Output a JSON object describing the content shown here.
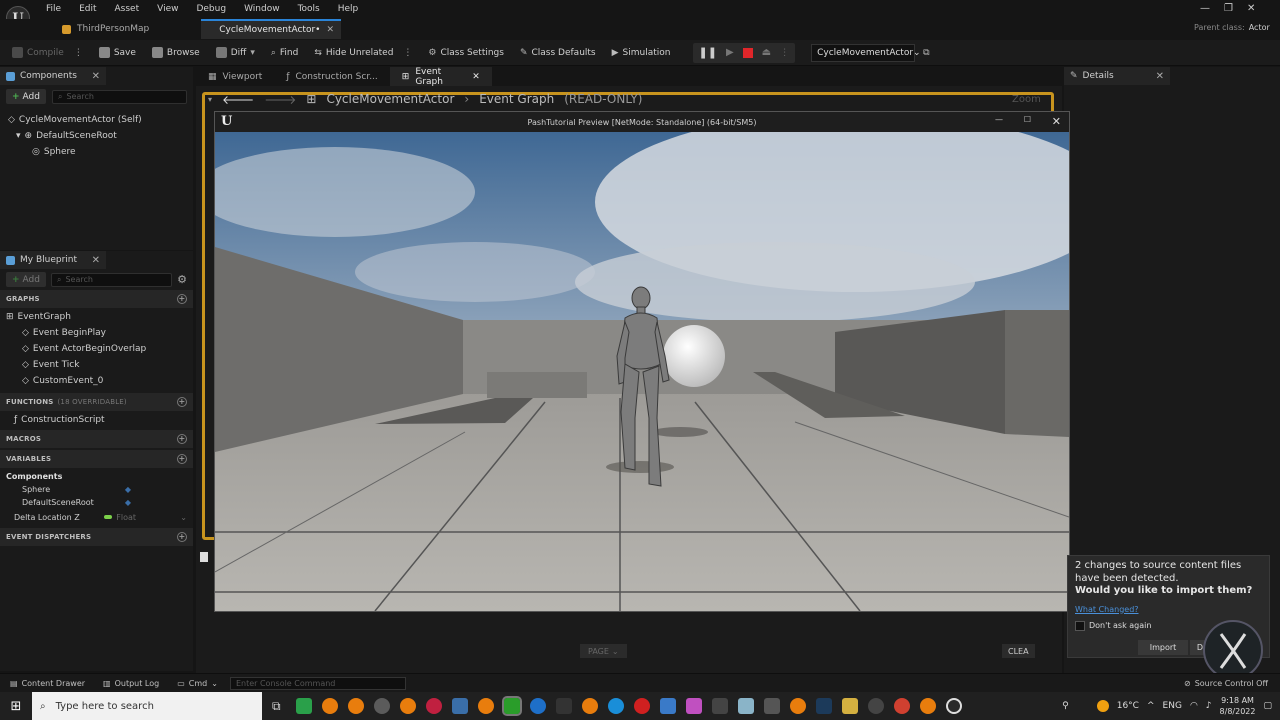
{
  "menubar": {
    "items": [
      "File",
      "Edit",
      "Asset",
      "View",
      "Debug",
      "Window",
      "Tools",
      "Help"
    ],
    "parent_class_label": "Parent class:",
    "parent_class_value": "Actor"
  },
  "tabs": [
    {
      "label": "ThirdPersonMap"
    },
    {
      "label": "CycleMovementActor•"
    }
  ],
  "toolbar": {
    "compile": "Compile",
    "save": "Save",
    "browse": "Browse",
    "diff": "Diff",
    "find": "Find",
    "hide_unrelated": "Hide Unrelated",
    "class_settings": "Class Settings",
    "class_defaults": "Class Defaults",
    "simulation": "Simulation",
    "debug_object": "CycleMovementActor"
  },
  "components_panel": {
    "title": "Components",
    "add": "Add",
    "search_placeholder": "Search",
    "tree": [
      "CycleMovementActor (Self)",
      "DefaultSceneRoot",
      "Sphere"
    ]
  },
  "my_blueprint": {
    "title": "My Blueprint",
    "add": "Add",
    "search_placeholder": "Search",
    "graphs_header": "GRAPHS",
    "event_graph": "EventGraph",
    "events": [
      "Event BeginPlay",
      "Event ActorBeginOverlap",
      "Event Tick",
      "CustomEvent_0"
    ],
    "functions_header": "FUNCTIONS",
    "functions_note": "(18 OVERRIDABLE)",
    "functions": [
      "ConstructionScript"
    ],
    "macros_header": "MACROS",
    "variables_header": "VARIABLES",
    "components_group": "Components",
    "component_vars": [
      "Sphere",
      "DefaultSceneRoot"
    ],
    "delta_var": "Delta Location Z",
    "delta_type": "Float",
    "dispatchers_header": "EVENT DISPATCHERS"
  },
  "center_tabs": [
    "Viewport",
    "Construction Scr...",
    "Event Graph"
  ],
  "graph_breadcrumb": {
    "actor": "CycleMovementActor",
    "graph": "Event Graph",
    "mode": "(READ-ONLY)",
    "zoom": "Zoom"
  },
  "game_window": {
    "title": "PashTutorial Preview [NetMode: Standalone]  (64-bit/SM5)"
  },
  "details": {
    "title": "Details"
  },
  "page_button": "PAGE",
  "clear_button": "CLEA",
  "notification": {
    "message_line1": "2 changes to source content files",
    "message_line2": "have been detected.",
    "question": "Would you like to import them?",
    "what_changed": "What Changed?",
    "dont_ask": "Don't ask again",
    "import": "Import",
    "dismiss": "D"
  },
  "statusbar": {
    "content_drawer": "Content Drawer",
    "output_log": "Output Log",
    "cmd": "Cmd",
    "console_placeholder": "Enter Console Command",
    "source_control": "Source Control Off"
  },
  "taskbar": {
    "search_placeholder": "Type here to search",
    "temperature": "16°C",
    "language": "ENG",
    "time": "9:18 AM",
    "date": "8/8/2022"
  }
}
